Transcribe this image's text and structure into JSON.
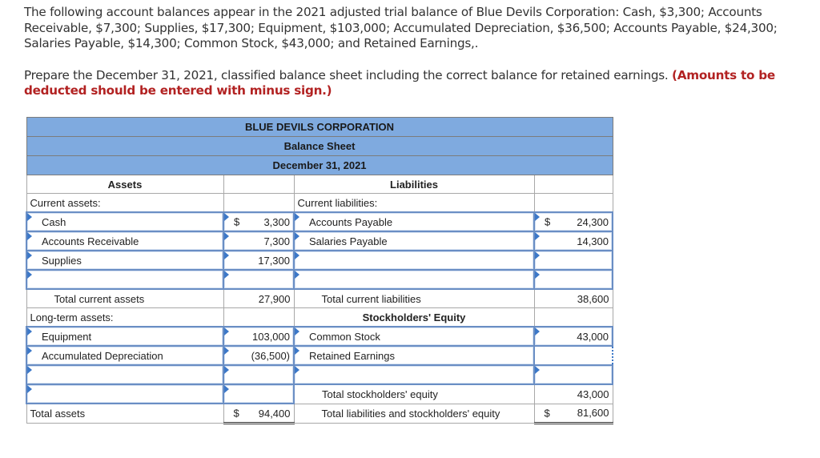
{
  "instructions": {
    "paragraph1": "The following account balances appear in the 2021 adjusted trial balance of Blue Devils Corporation: Cash, $3,300; Accounts Receivable, $7,300; Supplies, $17,300; Equipment, $103,000; Accumulated Depreciation, $36,500; Accounts Payable, $24,300; Salaries Payable, $14,300; Common Stock, $43,000; and Retained Earnings,.",
    "paragraph2": "Prepare the December 31, 2021, classified balance sheet including the correct balance for retained earnings.",
    "paragraph2_note": "(Amounts to be deducted should be entered with minus sign.)"
  },
  "balance_sheet": {
    "company": "BLUE DEVILS CORPORATION",
    "title": "Balance Sheet",
    "date": "December 31, 2021",
    "assets_header": "Assets",
    "liabilities_header": "Liabilities",
    "current_assets_label": "Current assets:",
    "current_liabilities_label": "Current liabilities:",
    "currency_symbol": "$",
    "rows": {
      "cash": {
        "label": "Cash",
        "amount": "3,300"
      },
      "accounts_receivable": {
        "label": "Accounts Receivable",
        "amount": "7,300"
      },
      "supplies": {
        "label": "Supplies",
        "amount": "17,300"
      },
      "blank_asset_1": {
        "label": "",
        "amount": ""
      },
      "accounts_payable": {
        "label": "Accounts Payable",
        "amount": "24,300"
      },
      "salaries_payable": {
        "label": "Salaries Payable",
        "amount": "14,300"
      },
      "blank_liab_1": {
        "label": "",
        "amount": ""
      },
      "blank_liab_2": {
        "label": "",
        "amount": ""
      },
      "total_current_assets": {
        "label": "Total current assets",
        "amount": "27,900"
      },
      "total_current_liabilities": {
        "label": "Total current liabilities",
        "amount": "38,600"
      },
      "long_term_assets_label": "Long-term assets:",
      "stockholders_equity_header": "Stockholders' Equity",
      "equipment": {
        "label": "Equipment",
        "amount": "103,000"
      },
      "accumulated_depreciation": {
        "label": "Accumulated Depreciation",
        "amount": "(36,500)"
      },
      "common_stock": {
        "label": "Common Stock",
        "amount": "43,000"
      },
      "retained_earnings": {
        "label": "Retained Earnings",
        "amount": ""
      },
      "blank_asset_2": {
        "label": "",
        "amount": ""
      },
      "blank_asset_3": {
        "label": "",
        "amount": ""
      },
      "blank_equity_1": {
        "label": "",
        "amount": ""
      },
      "total_stockholders_equity": {
        "label": "Total stockholders' equity",
        "amount": "43,000"
      },
      "total_assets": {
        "label": "Total assets",
        "amount": "94,400"
      },
      "total_liabilities_equity": {
        "label": "Total liabilities and stockholders' equity",
        "amount": "81,600"
      }
    }
  }
}
